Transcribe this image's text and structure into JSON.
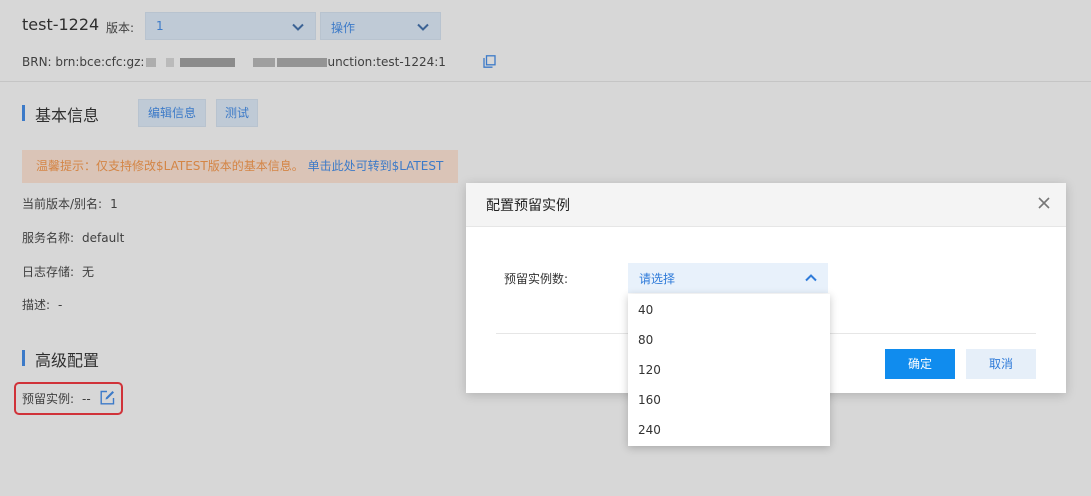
{
  "header": {
    "function_name": "test-1224",
    "version_label": "版本:",
    "version_value": "1",
    "ops_label": "操作",
    "brn_prefix": "BRN: brn:bce:cfc:gz:",
    "brn_suffix": "unction:test-1224:1"
  },
  "basic": {
    "title": "基本信息",
    "edit_label": "编辑信息",
    "test_label": "测试",
    "tip_text": "温馨提示：仅支持修改$LATEST版本的基本信息。",
    "tip_link": "单击此处可转到$LATEST",
    "rows": [
      {
        "label": "当前版本/别名:",
        "value": "1"
      },
      {
        "label": "服务名称:",
        "value": "default"
      },
      {
        "label": "日志存储:",
        "value": "无"
      },
      {
        "label": "描述:",
        "value": "-"
      }
    ]
  },
  "advanced": {
    "title": "高级配置",
    "reserved_label": "预留实例:",
    "reserved_value": "--"
  },
  "modal": {
    "title": "配置预留实例",
    "field_label": "预留实例数:",
    "placeholder": "请选择",
    "confirm": "确定",
    "cancel": "取消",
    "options": [
      "40",
      "80",
      "120",
      "160",
      "240"
    ]
  },
  "colors": {
    "accent": "#2f7bd9",
    "primary_button": "#108cee",
    "warning_text": "#e8883a",
    "highlight_box": "#e3232b"
  },
  "icons": [
    "chevron-down-icon",
    "copy-icon",
    "edit-icon",
    "close-icon",
    "chevron-up-icon"
  ]
}
